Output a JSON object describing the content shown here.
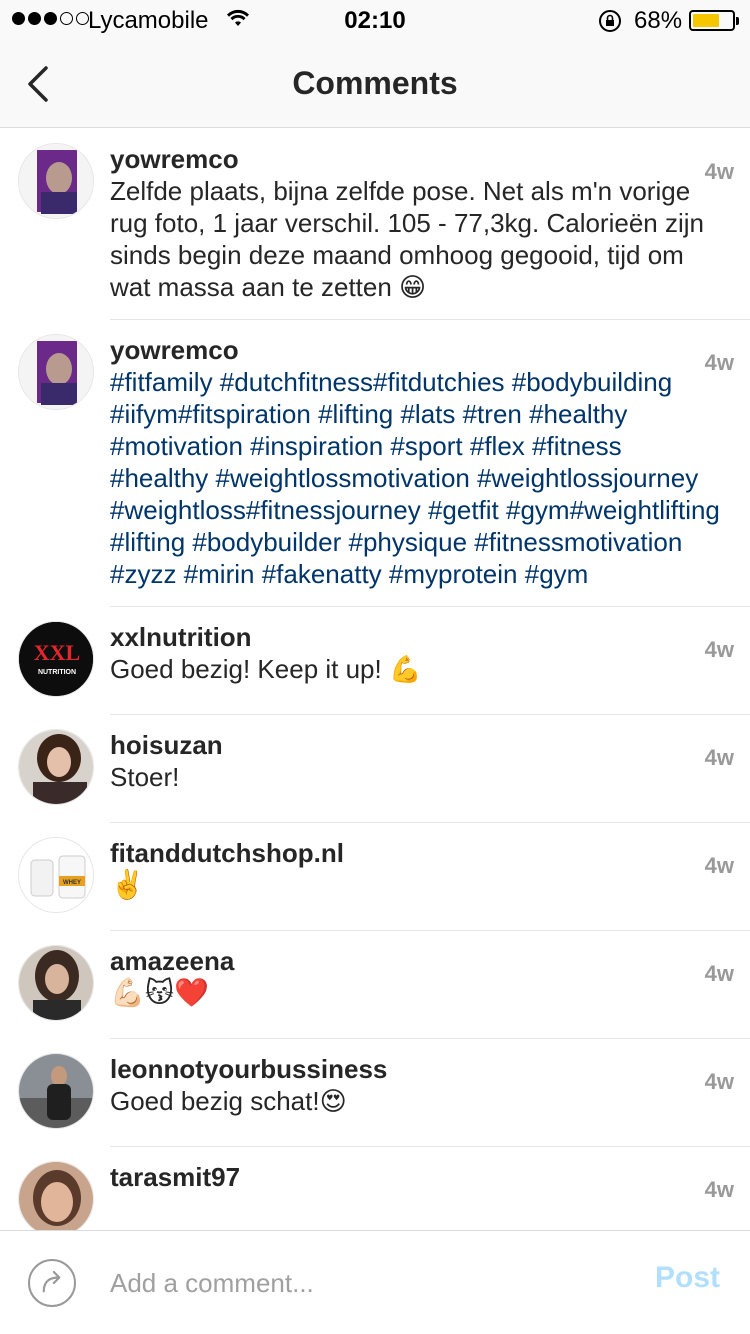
{
  "status_bar": {
    "carrier": "Lycamobile",
    "time": "02:10",
    "battery_percent": "68%"
  },
  "nav": {
    "title": "Comments"
  },
  "comments": [
    {
      "username": "yowremco",
      "time": "4w",
      "text": "Zelfde plaats, bijna zelfde pose. Net als m'n vorige rug foto, 1 jaar verschil. 105 - 77,3kg. Calorieën zijn sinds begin deze maand omhoog gegooid, tijd om wat massa aan te zetten 😁"
    },
    {
      "username": "yowremco",
      "time": "4w",
      "hashtags": "#fitfamily #dutchfitness#fitdutchies #bodybuilding #iifym#fitspiration #lifting #lats #tren #healthy #motivation #inspiration #sport #flex #fitness #healthy #weightlossmotivation #weightlossjourney #weightloss#fitnessjourney #getfit #gym#weightlifting #lifting #bodybuilder #physique #fitnessmotivation #zyzz #mirin #fakenatty #myprotein #gym"
    },
    {
      "username": "xxlnutrition",
      "time": "4w",
      "text": "Goed bezig! Keep it up! 💪"
    },
    {
      "username": "hoisuzan",
      "time": "4w",
      "text": "Stoer!"
    },
    {
      "username": "fitanddutchshop.nl",
      "time": "4w",
      "text": "✌️"
    },
    {
      "username": "amazeena",
      "time": "4w",
      "text": "💪🏻😽❤️"
    },
    {
      "username": "leonnotyourbussiness",
      "time": "4w",
      "text": "Goed bezig schat!😍"
    },
    {
      "username": "tarasmit97",
      "time": "4w",
      "text": ""
    }
  ],
  "avatar_logos": {
    "xxl_top": "XXL",
    "xxl_bottom": "NUTRITION",
    "whey": "WHEY"
  },
  "composer": {
    "placeholder": "Add a comment...",
    "post_label": "Post"
  }
}
